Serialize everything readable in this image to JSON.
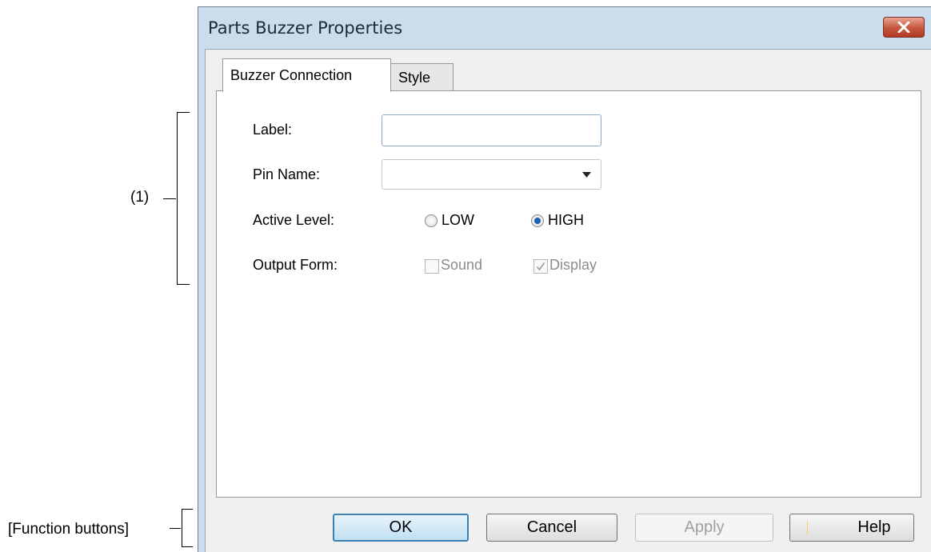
{
  "annotations": {
    "section1": "(1)",
    "function_buttons": "[Function buttons]"
  },
  "dialog": {
    "title": "Parts Buzzer Properties",
    "tabs": [
      {
        "label": "Buzzer Connection",
        "active": true
      },
      {
        "label": "Style",
        "active": false
      }
    ],
    "fields": {
      "label": {
        "caption": "Label:",
        "value": ""
      },
      "pin_name": {
        "caption": "Pin Name:",
        "value": ""
      },
      "active_level": {
        "caption": "Active Level:",
        "options": [
          {
            "label": "LOW",
            "selected": false
          },
          {
            "label": "HIGH",
            "selected": true
          }
        ]
      },
      "output_form": {
        "caption": "Output Form:",
        "options": [
          {
            "label": "Sound",
            "checked": false,
            "enabled": false
          },
          {
            "label": "Display",
            "checked": true,
            "enabled": false
          }
        ]
      }
    },
    "buttons": {
      "ok": "OK",
      "cancel": "Cancel",
      "apply": "Apply",
      "help": "Help"
    }
  },
  "colors": {
    "frame": "#cbdcec",
    "close_button": "#c5553e",
    "radio_selected": "#1f5fb3",
    "default_button_border": "#3c7fb1"
  },
  "icons": {
    "close": "close-icon",
    "dropdown": "chevron-down-icon",
    "check": "checkmark-icon"
  }
}
